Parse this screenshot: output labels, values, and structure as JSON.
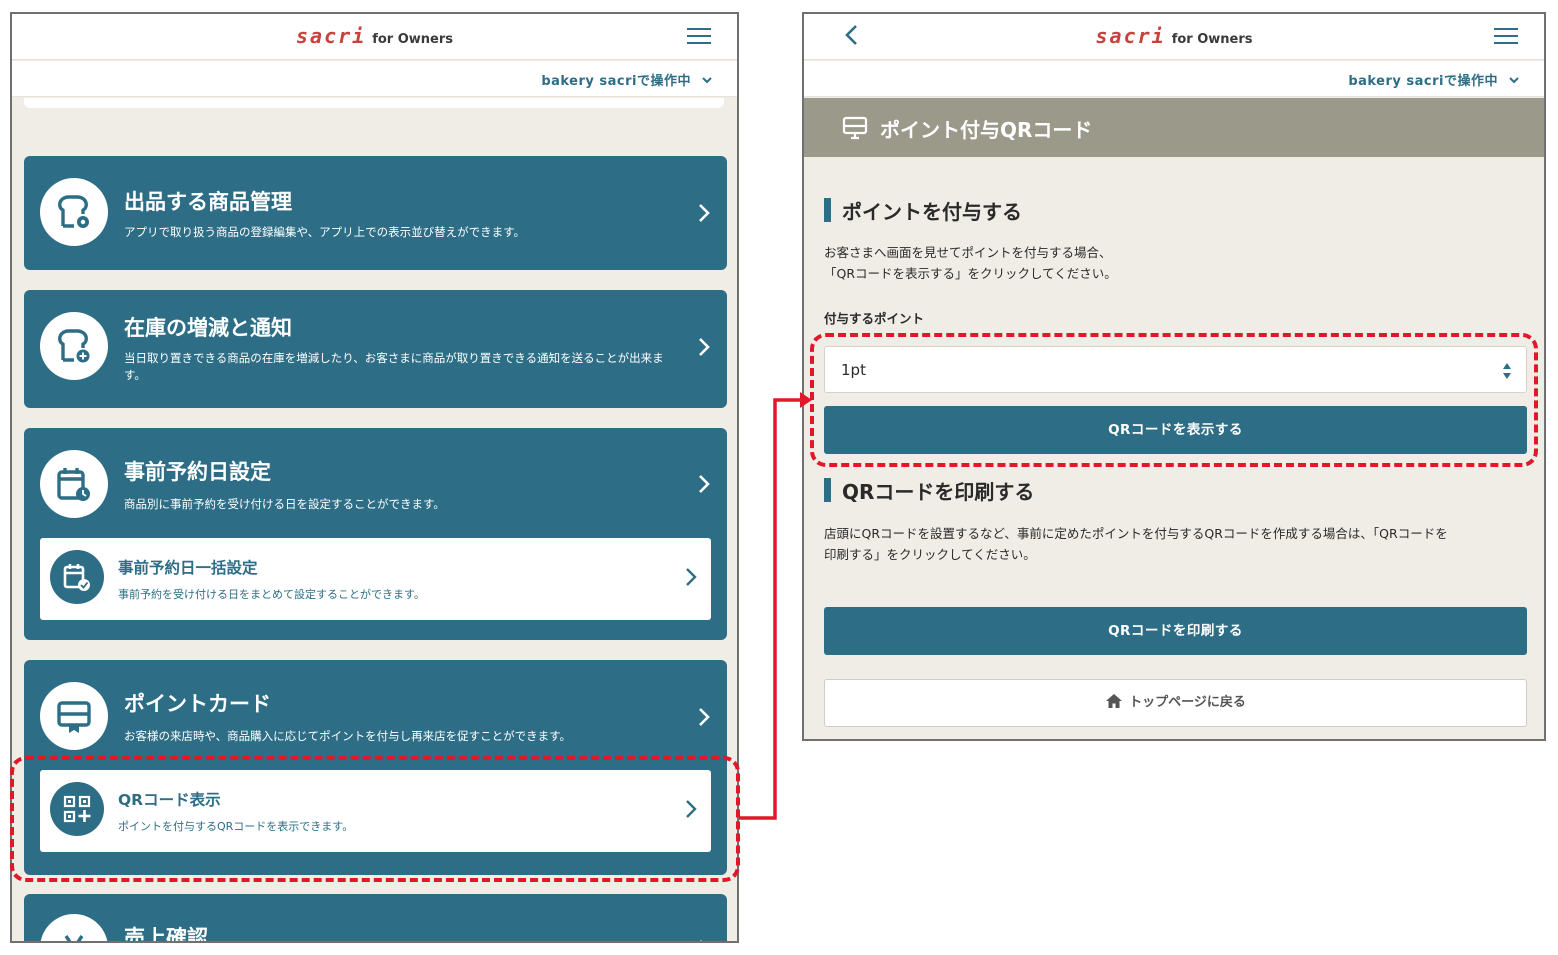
{
  "colors": {
    "brand_teal": "#2d6e86",
    "background": "#efede5",
    "banner": "#9a998a",
    "logo_red": "#c9413b",
    "annotation_red": "#e0182a"
  },
  "left_screen": {
    "logo": {
      "main": "sacri",
      "sub": "for Owners"
    },
    "shop_selector": {
      "label": "bakery sacriで操作中"
    },
    "icons": {
      "menu": "hamburger-icon",
      "shop_dropdown": "chevron-down-icon"
    },
    "menu_items": [
      {
        "title": "出品する商品管理",
        "description": "アプリで取り扱う商品の登録編集や、アプリ上での表示並び替えができます。",
        "icon": "bread-gear-icon"
      },
      {
        "title": "在庫の増減と通知",
        "description": "当日取り置きできる商品の在庫を増減したり、お客さまに商品が取り置きできる通知を送ることが出来ます。",
        "icon": "bread-plus-icon"
      },
      {
        "title": "事前予約日設定",
        "description": "商品別に事前予約を受け付ける日を設定することができます。",
        "icon": "calendar-clock-icon",
        "sub_item": {
          "title": "事前予約日一括設定",
          "description": "事前予約を受け付ける日をまとめて設定することができます。",
          "icon": "calendar-check-icon"
        }
      },
      {
        "title": "ポイントカード",
        "description": "お客様の来店時や、商品購入に応じてポイントを付与し再来店を促すことができます。",
        "icon": "point-card-icon",
        "sub_item": {
          "title": "QRコード表示",
          "description": "ポイントを付与するQRコードを表示できます。",
          "icon": "qr-code-plus-icon"
        }
      },
      {
        "title": "売上確認",
        "icon": "yen-icon"
      }
    ]
  },
  "right_screen": {
    "logo": {
      "main": "sacri",
      "sub": "for Owners"
    },
    "shop_selector": {
      "label": "bakery sacriで操作中"
    },
    "icons": {
      "back": "chevron-left-icon",
      "menu": "hamburger-icon",
      "banner": "monitor-icon",
      "home": "home-icon"
    },
    "page_title": "ポイント付与QRコード",
    "grant_section": {
      "heading": "ポイントを付与する",
      "description": [
        "お客さまへ画面を見せてポイントを付与する場合、",
        "「QRコードを表示する」をクリックしてください。"
      ],
      "field_label": "付与するポイント",
      "select_value": "1pt",
      "show_button": "QRコードを表示する"
    },
    "print_section": {
      "heading": "QRコードを印刷する",
      "description": [
        "店頭にQRコードを設置するなど、事前に定めたポイントを付与するQRコードを作成する場合は、「QRコードを",
        "印刷する」をクリックしてください。"
      ],
      "print_button": "QRコードを印刷する"
    },
    "back_to_top": "トップページに戻る"
  }
}
